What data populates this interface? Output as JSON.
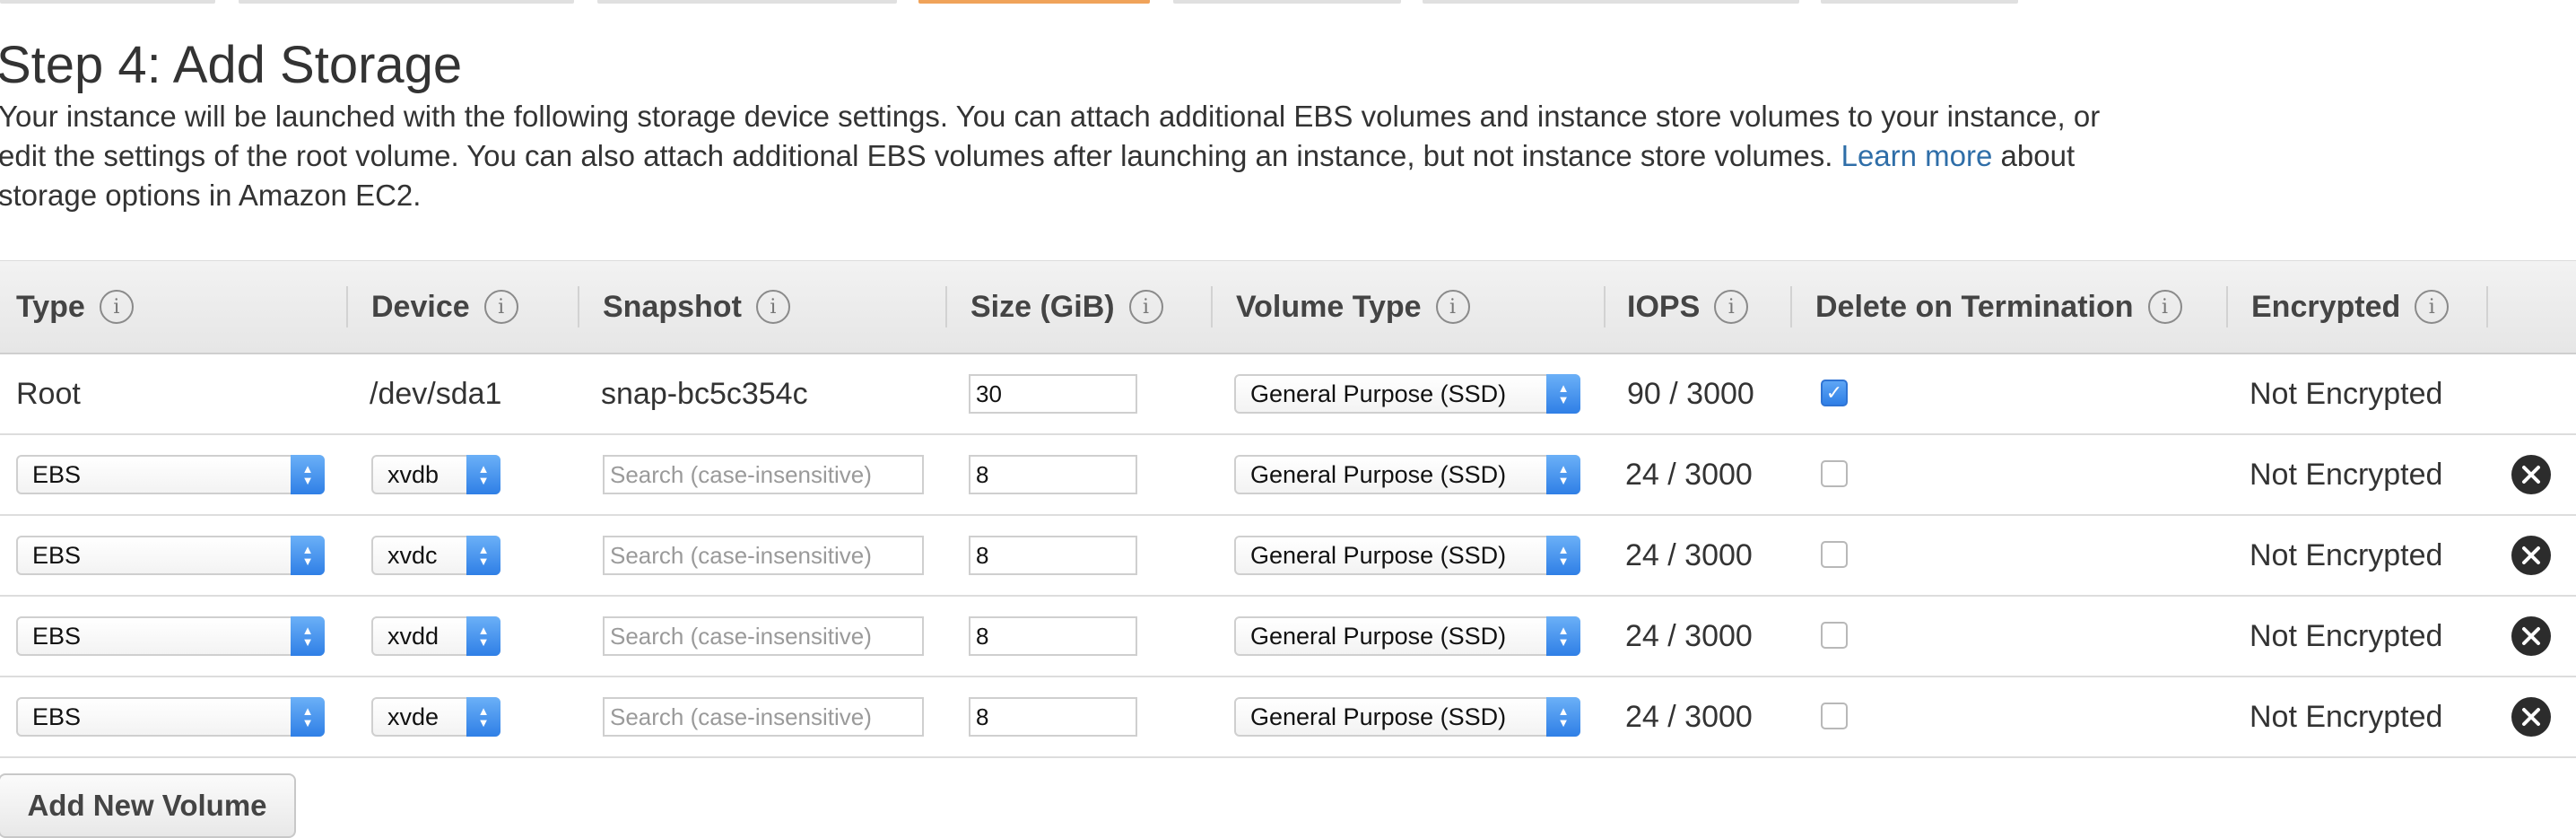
{
  "page": {
    "title": "Step 4: Add Storage",
    "description_line1": "Your instance will be launched with the following storage device settings. You can attach additional EBS volumes and instance store volumes to your instance, or",
    "description_line2_pre": "edit the settings of the root volume. You can also attach additional EBS volumes after launching an instance, but not instance store volumes.",
    "learn_more": "Learn more",
    "description_line2_post": "about",
    "description_line3": "storage options in Amazon EC2."
  },
  "table": {
    "headers": {
      "type": "Type",
      "device": "Device",
      "snapshot": "Snapshot",
      "size": "Size (GiB)",
      "volume_type": "Volume Type",
      "iops": "IOPS",
      "delete_on_termination": "Delete on Termination",
      "encrypted": "Encrypted"
    },
    "info_glyph": "i",
    "root": {
      "type": "Root",
      "device": "/dev/sda1",
      "snapshot": "snap-bc5c354c",
      "size": "30",
      "volume_type": "General Purpose (SSD)",
      "iops": "90 / 3000",
      "delete_on_termination": true,
      "encrypted": "Not Encrypted"
    },
    "ebs_rows": [
      {
        "type": "EBS",
        "device": "xvdb",
        "snapshot_placeholder": "Search (case-insensitive)",
        "size": "8",
        "volume_type": "General Purpose (SSD)",
        "iops": "24 / 3000",
        "delete_on_termination": false,
        "encrypted": "Not Encrypted"
      },
      {
        "type": "EBS",
        "device": "xvdc",
        "snapshot_placeholder": "Search (case-insensitive)",
        "size": "8",
        "volume_type": "General Purpose (SSD)",
        "iops": "24 / 3000",
        "delete_on_termination": false,
        "encrypted": "Not Encrypted"
      },
      {
        "type": "EBS",
        "device": "xvdd",
        "snapshot_placeholder": "Search (case-insensitive)",
        "size": "8",
        "volume_type": "General Purpose (SSD)",
        "iops": "24 / 3000",
        "delete_on_termination": false,
        "encrypted": "Not Encrypted"
      },
      {
        "type": "EBS",
        "device": "xvde",
        "snapshot_placeholder": "Search (case-insensitive)",
        "size": "8",
        "volume_type": "General Purpose (SSD)",
        "iops": "24 / 3000",
        "delete_on_termination": false,
        "encrypted": "Not Encrypted"
      }
    ]
  },
  "actions": {
    "add_new_volume": "Add New Volume"
  },
  "colors": {
    "link": "#2f6ea8",
    "select_accent": "#2f7fe6",
    "active_tab": "#f0a35a"
  }
}
